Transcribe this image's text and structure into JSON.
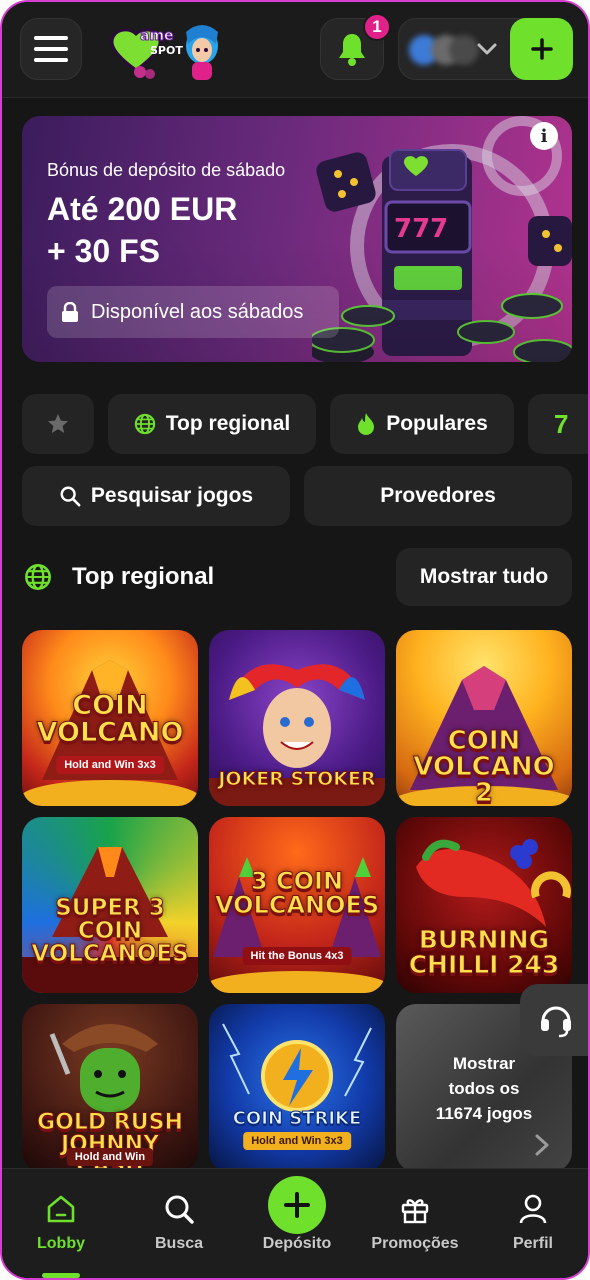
{
  "header": {
    "logo_text": "Game SPOT",
    "notification_count": "1",
    "accent_color": "#6fe02c"
  },
  "banner": {
    "subtitle": "Bónus de depósito de sábado",
    "title_line1": "Até 200 EUR",
    "title_line2": "+ 30 FS",
    "availability": "Disponível aos sábados",
    "info_label": "i"
  },
  "chips": {
    "favorites_icon": "star-icon",
    "top_regional": "Top regional",
    "popular": "Populares",
    "partial": "7",
    "search": "Pesquisar jogos",
    "providers": "Provedores"
  },
  "section": {
    "title": "Top regional",
    "show_all": "Mostrar tudo"
  },
  "games": [
    {
      "name": "Coin Volcano",
      "sub": "Hold and Win 3x3"
    },
    {
      "name": "Joker Stoker",
      "sub": ""
    },
    {
      "name": "Coin Volcano 2",
      "sub": ""
    },
    {
      "name": "Super 3 Coin Volcanoes",
      "sub": ""
    },
    {
      "name": "3 Coin Volcanoes",
      "sub": "Hit the Bonus 4x3"
    },
    {
      "name": "Burning Chilli 243",
      "sub": ""
    },
    {
      "name": "Gold Rush Johnny Cash",
      "sub": "Hold and Win"
    },
    {
      "name": "Coin Strike",
      "sub": "Hold and Win 3x3"
    }
  ],
  "more_tile": {
    "line1": "Mostrar",
    "line2": "todos os",
    "line3": "11674 jogos"
  },
  "nav": {
    "lobby": "Lobby",
    "search": "Busca",
    "deposit": "Depósito",
    "promotions": "Promoções",
    "profile": "Perfil",
    "active": "Lobby"
  }
}
